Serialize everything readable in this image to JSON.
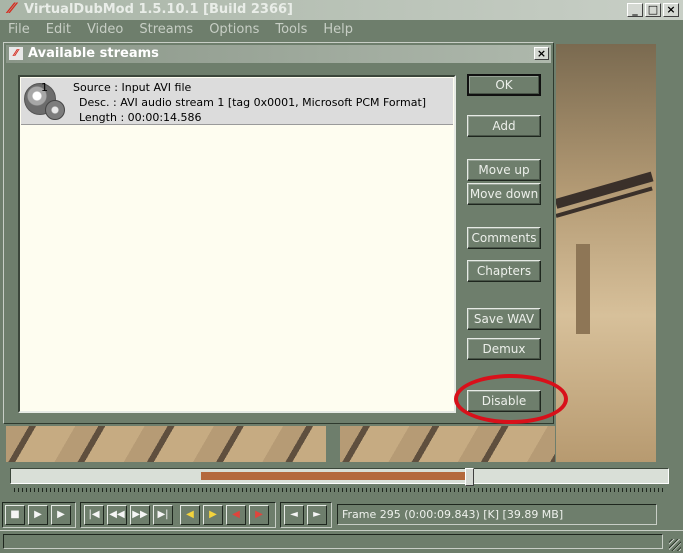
{
  "main_window": {
    "title": "VirtualDubMod 1.5.10.1 [Build 2366]",
    "menu": [
      "File",
      "Edit",
      "Video",
      "Streams",
      "Options",
      "Tools",
      "Help"
    ],
    "buttons": {
      "minimize": "_",
      "maximize": "□",
      "close": "×"
    }
  },
  "dialog": {
    "title": "Available streams",
    "close_label": "×",
    "streams": [
      {
        "number": "1",
        "source": "Source : Input AVI file",
        "desc": "Desc. : AVI audio stream 1 [tag 0x0001, Microsoft PCM Format]",
        "length": "Length : 00:00:14.586"
      }
    ],
    "buttons": {
      "ok": "OK",
      "add": "Add",
      "move_up": "Move up",
      "move_down": "Move down",
      "comments": "Comments",
      "chapters": "Chapters",
      "save_wav": "Save WAV",
      "demux": "Demux",
      "disable": "Disable"
    },
    "annotation_color": "#d8101a"
  },
  "position": {
    "frame_label": "Frame 295 (0:00:09.843) [K] [39.89 MB]"
  },
  "toolbar": {
    "stop": "■",
    "play_input": "▶",
    "play_output": "▶",
    "start": "|◀",
    "prev_key": "◀◀",
    "next_key": "▶▶",
    "end": "▶|",
    "prev_scene": "◀",
    "next_scene": "▶",
    "mark_in": "◀",
    "mark_out": "▶",
    "nav_left": "◄",
    "nav_right": "►"
  }
}
